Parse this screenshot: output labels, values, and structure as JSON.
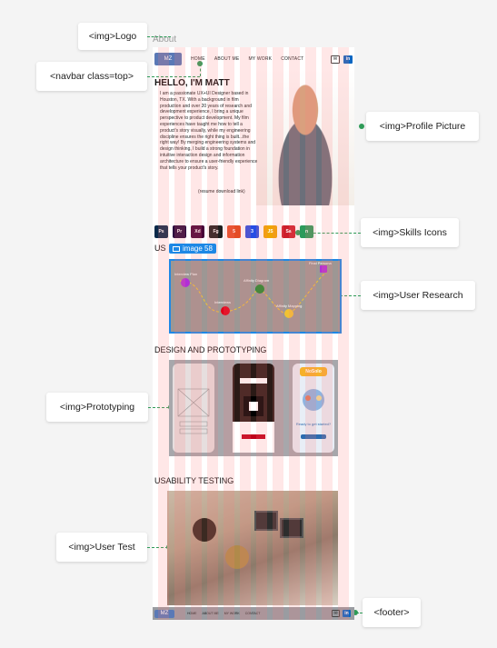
{
  "page": {
    "about_tag": "About"
  },
  "navbar": {
    "logo_text": "MZ",
    "links": [
      "HOME",
      "ABOUT ME",
      "MY WORK",
      "CONTACT"
    ],
    "icons": [
      "mail-icon",
      "linkedin-icon"
    ],
    "linkedin_glyph": "in"
  },
  "hero": {
    "heading": "HELLO, I'M MATT",
    "bio": "I am a passionate UX+UI Designer based in Houston, TX. With a background in film production and over 20 years of research and development experience, I bring a unique perspective to product development. My film experiences have taught me how to tell a product's story visually, while my engineering discipline ensures the right thing is built...the right way! By merging engineering systems and design thinking, I build a strong foundation in intuitive interaction design and information architecture to ensure a user-friendly experience that tells your product's story.",
    "resume_link": "(resume download link)"
  },
  "skills": {
    "items": [
      {
        "label": "Ps",
        "color": "#0b2a4a"
      },
      {
        "label": "Pr",
        "color": "#2a0a3e"
      },
      {
        "label": "Xd",
        "color": "#470137"
      },
      {
        "label": "Fg",
        "color": "#1e1e1e"
      },
      {
        "label": "5",
        "color": "#e44d26"
      },
      {
        "label": "3",
        "color": "#264de4"
      },
      {
        "label": "JS",
        "color": "#f0a500"
      },
      {
        "label": "Sa",
        "color": "#cd1f2b"
      },
      {
        "label": "n",
        "color": "#2c9b5c"
      }
    ]
  },
  "sections": {
    "user_research": "US",
    "selection_badge": "image 58",
    "design": "DESIGN AND PROTOTYPING",
    "usability": "USABILITY TESTING"
  },
  "research_map": {
    "points": [
      "Interview Plan",
      "Interviews",
      "Affinity Diagram",
      "Affinity Mapping",
      "Final Persona"
    ]
  },
  "prototype": {
    "screen3_logo": "NoSolo",
    "screen3_cta": "Ready to get started?"
  },
  "footer": {
    "links": [
      "HOME",
      "ABOUT ME",
      "MY WORK",
      "CONTACT"
    ]
  },
  "annotations": {
    "logo": "<img>Logo",
    "navbar": "<navbar class=top>",
    "profile": "<img>Profile Picture",
    "skills": "<img>Skills Icons",
    "research": "<img>User Research",
    "prototyping": "<img>Prototyping",
    "user_test": "<img>User Test",
    "footer": "<footer>"
  }
}
